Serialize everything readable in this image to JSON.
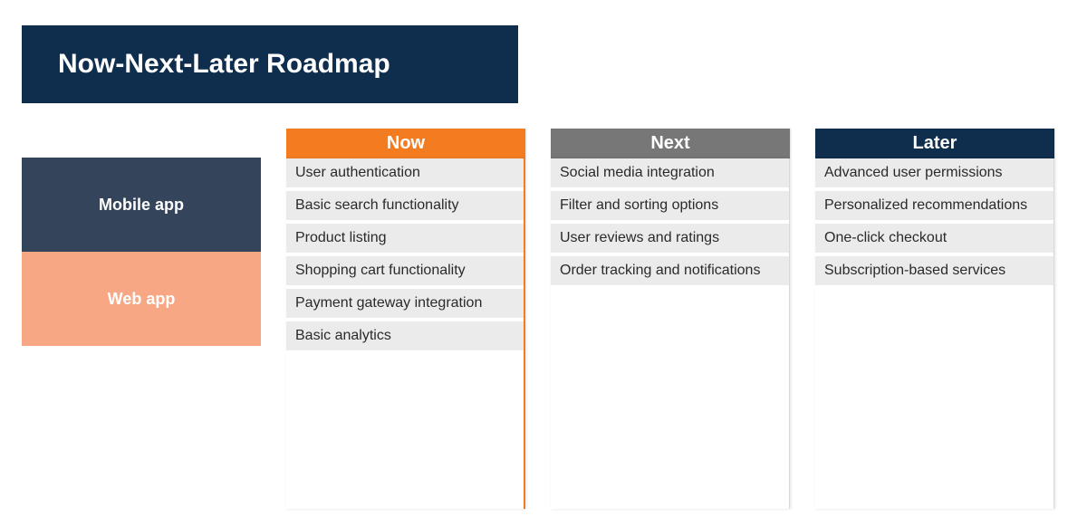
{
  "title": "Now-Next-Later Roadmap",
  "categories": [
    {
      "label": "Mobile app",
      "color": "#34455b"
    },
    {
      "label": "Web app",
      "color": "#f8a784"
    }
  ],
  "columns": [
    {
      "header": "Now",
      "header_color": "#f47c20",
      "items": [
        "User authentication",
        "Basic search functionality",
        "Product listing",
        "Shopping cart functionality",
        "Payment gateway integration",
        "Basic analytics"
      ]
    },
    {
      "header": "Next",
      "header_color": "#777777",
      "items": [
        "Social media integration",
        "Filter and sorting options",
        "User reviews and ratings",
        "Order tracking and notifications"
      ]
    },
    {
      "header": "Later",
      "header_color": "#0f2d4d",
      "items": [
        "Advanced user permissions",
        "Personalized recommendations",
        "One-click checkout",
        "Subscription-based services"
      ]
    }
  ]
}
